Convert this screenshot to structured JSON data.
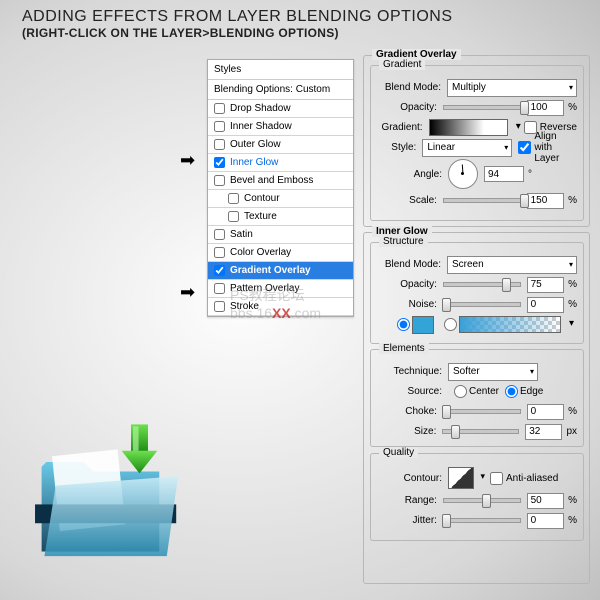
{
  "title": {
    "main": "ADDING EFFECTS FROM LAYER BLENDING OPTIONS",
    "sub": "(RIGHT-CLICK ON THE LAYER>BLENDING OPTIONS)"
  },
  "styles": {
    "header": "Styles",
    "sub": "Blending Options: Custom",
    "items": [
      {
        "label": "Drop Shadow",
        "chk": false
      },
      {
        "label": "Inner Shadow",
        "chk": false
      },
      {
        "label": "Outer Glow",
        "chk": false
      },
      {
        "label": "Inner Glow",
        "chk": true,
        "sel": "blue"
      },
      {
        "label": "Bevel and Emboss",
        "chk": false
      },
      {
        "label": "Contour",
        "chk": false,
        "indent": true
      },
      {
        "label": "Texture",
        "chk": false,
        "indent": true
      },
      {
        "label": "Satin",
        "chk": false
      },
      {
        "label": "Color Overlay",
        "chk": false
      },
      {
        "label": "Gradient Overlay",
        "chk": true,
        "sel": "bg"
      },
      {
        "label": "Pattern Overlay",
        "chk": false
      },
      {
        "label": "Stroke",
        "chk": false
      }
    ]
  },
  "gradientOverlay": {
    "legend": "Gradient Overlay",
    "gradient": {
      "legend": "Gradient",
      "blendModeLbl": "Blend Mode:",
      "blendMode": "Multiply",
      "opacityLbl": "Opacity:",
      "opacity": "100",
      "opacityUnit": "%",
      "gradientLbl": "Gradient:",
      "reverse": "Reverse",
      "styleLbl": "Style:",
      "style": "Linear",
      "align": "Align with Layer",
      "angleLbl": "Angle:",
      "angle": "94",
      "angleUnit": "°",
      "scaleLbl": "Scale:",
      "scale": "150",
      "scaleUnit": "%"
    }
  },
  "innerGlow": {
    "legend": "Inner Glow",
    "structure": {
      "legend": "Structure",
      "blendModeLbl": "Blend Mode:",
      "blendMode": "Screen",
      "opacityLbl": "Opacity:",
      "opacity": "75",
      "opacityUnit": "%",
      "noiseLbl": "Noise:",
      "noise": "0",
      "noiseUnit": "%"
    },
    "elements": {
      "legend": "Elements",
      "techniqueLbl": "Technique:",
      "technique": "Softer",
      "sourceLbl": "Source:",
      "center": "Center",
      "edge": "Edge",
      "chokeLbl": "Choke:",
      "choke": "0",
      "chokeUnit": "%",
      "sizeLbl": "Size:",
      "size": "32",
      "sizeUnit": "px"
    },
    "quality": {
      "legend": "Quality",
      "contourLbl": "Contour:",
      "anti": "Anti-aliased",
      "rangeLbl": "Range:",
      "range": "50",
      "rangeUnit": "%",
      "jitterLbl": "Jitter:",
      "jitter": "0",
      "jitterUnit": "%"
    }
  },
  "watermark": {
    "t1": "PS教程论坛",
    "t2": "bbs.16",
    "xx": "XX",
    "t3": ".com"
  }
}
